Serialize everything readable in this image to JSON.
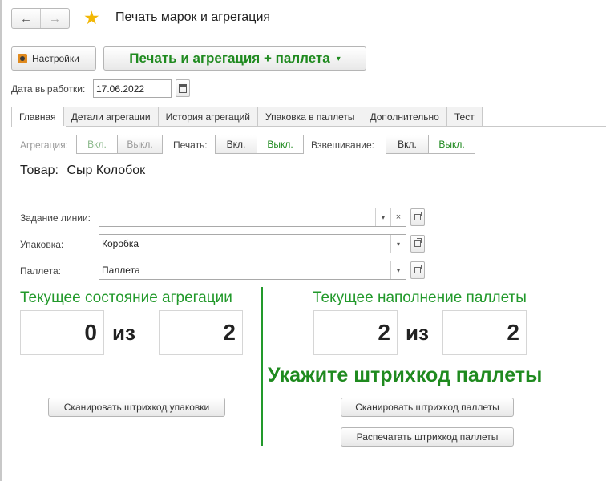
{
  "window": {
    "title": "Печать марок и агрегация",
    "nav_back": "←",
    "nav_forward": "→",
    "favorite_icon": "★"
  },
  "toolbar": {
    "settings_label": "Настройки",
    "print_agg_label": "Печать и агрегация + паллета",
    "print_agg_caret": "▾"
  },
  "production_date": {
    "label": "Дата выработки:",
    "value": "17.06.2022"
  },
  "tabs": [
    {
      "label": "Главная",
      "active": true
    },
    {
      "label": "Детали агрегации",
      "active": false
    },
    {
      "label": "История агрегаций",
      "active": false
    },
    {
      "label": "Упаковка в паллеты",
      "active": false
    },
    {
      "label": "Дополнительно",
      "active": false
    },
    {
      "label": "Тест",
      "active": false
    }
  ],
  "toggles": {
    "aggregation": {
      "label": "Агрегация:",
      "on": "Вкл.",
      "off": "Выкл."
    },
    "print": {
      "label": "Печать:",
      "on": "Вкл.",
      "off": "Выкл."
    },
    "weighing": {
      "label": "Взвешивание:",
      "on": "Вкл.",
      "off": "Выкл."
    }
  },
  "goods": {
    "label": "Товар:",
    "value": "Сыр Колобок"
  },
  "fields": {
    "line_task": {
      "label": "Задание линии:",
      "value": ""
    },
    "package": {
      "label": "Упаковка:",
      "value": "Коробка"
    },
    "pallet": {
      "label": "Паллета:",
      "value": "Паллета"
    },
    "dropdown_glyph": "▾",
    "clear_glyph": "×"
  },
  "aggregation_state": {
    "title": "Текущее состояние агрегации",
    "current": "0",
    "of": "из",
    "total": "2",
    "scan_button": "Сканировать штрихкод упаковки"
  },
  "pallet_fill": {
    "title": "Текущее наполнение паллеты",
    "current": "2",
    "of": "из",
    "total": "2",
    "prompt": "Укажите штрихкод паллеты",
    "scan_button": "Сканировать штрихкод паллеты",
    "print_button": "Распечатать штрихкод паллеты"
  },
  "colors": {
    "accent_green": "#1f8a1f",
    "header_green": "#22992b",
    "star": "#f2b705"
  }
}
